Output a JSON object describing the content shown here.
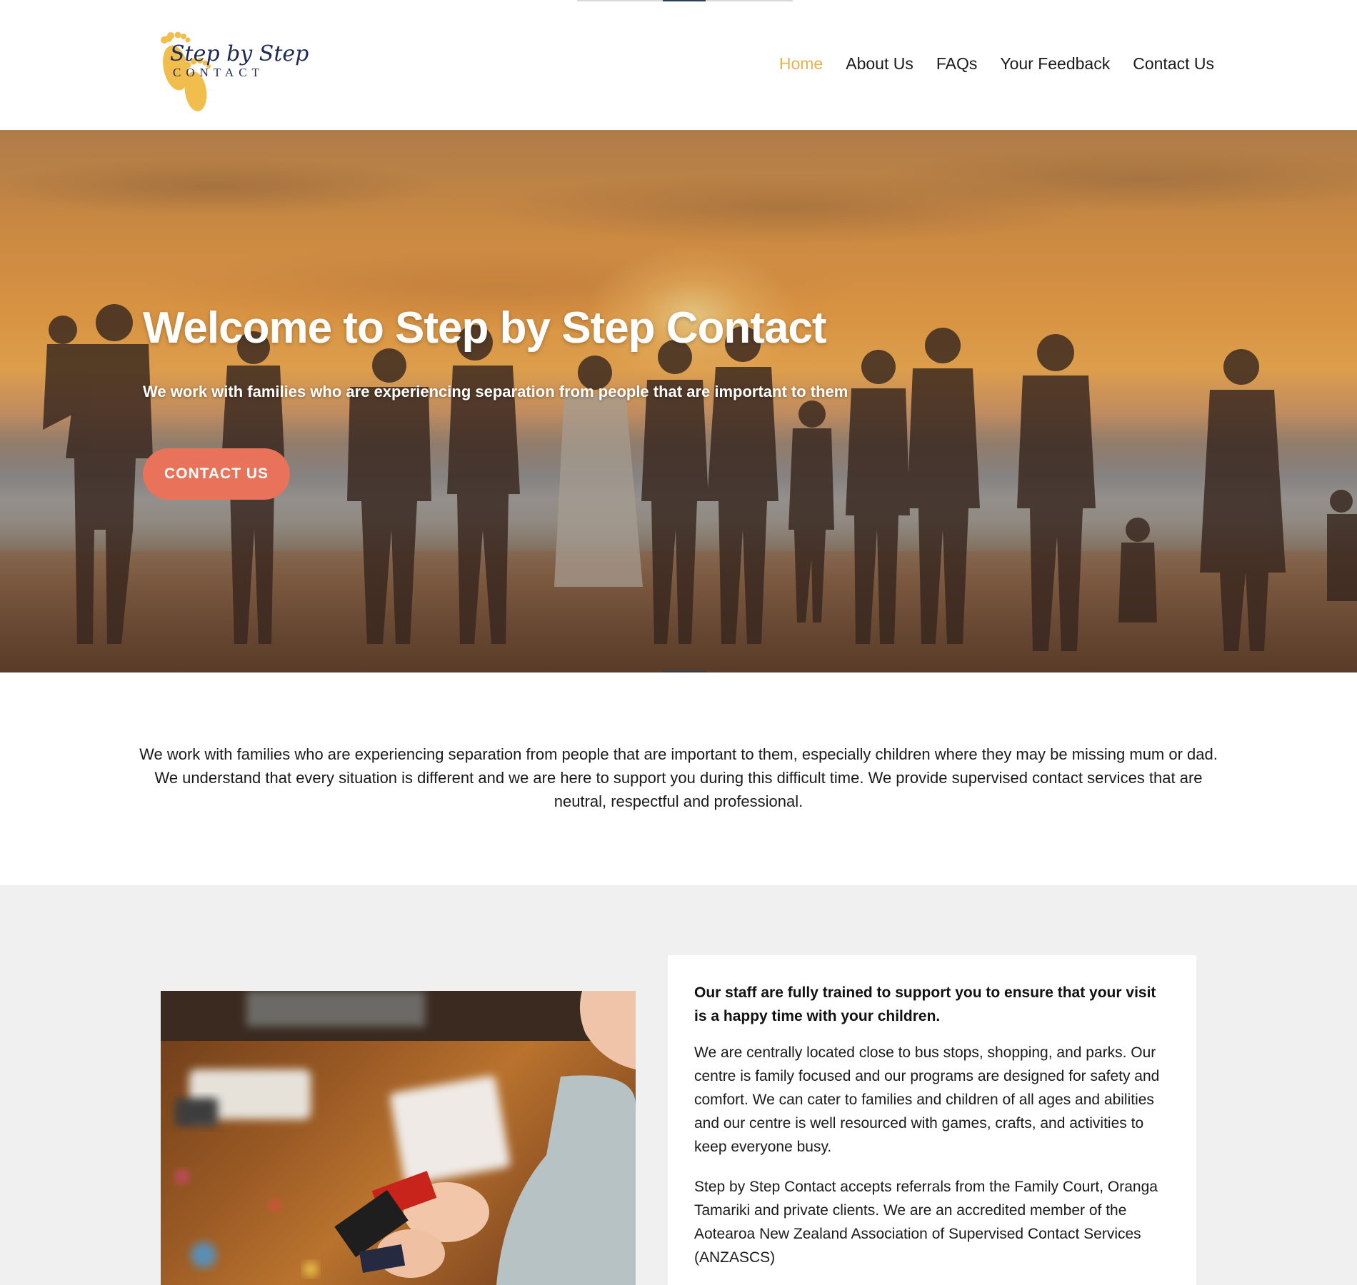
{
  "brand": {
    "logo_script": "Step by Step",
    "logo_subtitle": "CONTACT",
    "logo_color": "#f1be4e",
    "logo_text_color": "#1f2a55"
  },
  "nav": {
    "items": [
      {
        "label": "Home",
        "active": true
      },
      {
        "label": "About Us",
        "active": false
      },
      {
        "label": "FAQs",
        "active": false
      },
      {
        "label": "Your Feedback",
        "active": false
      },
      {
        "label": "Contact Us",
        "active": false
      }
    ],
    "active_color": "#e8b04e"
  },
  "hero": {
    "title": "Welcome to Step by Step Contact",
    "subtitle": "We work with families who are experiencing separation from people that are important to them",
    "button_label": "CONTACT US",
    "button_color": "#e8735a",
    "image": "family-holding-hands-on-beach-at-sunset"
  },
  "intro": {
    "text": "We work with families who are experiencing separation from people that are important to them, especially children where they may be missing mum or dad. We understand that every situation is different and we are here to support you during this difficult time. We provide supervised contact services that are neutral, respectful and professional."
  },
  "info": {
    "image": "child-playing-with-toy-blocks",
    "lead": "Our staff are fully trained to support you to ensure that your visit is a happy time with your children.",
    "paragraph_1": "We are centrally located close to bus stops, shopping, and parks. Our centre is family focused and our programs are designed for safety and comfort. We can cater to families and children of all ages and abilities and our centre is well resourced with games, crafts, and activities to keep everyone busy.",
    "paragraph_2": "Step by Step Contact accepts referrals from the Family Court, Oranga Tamariki and private clients. We are an accredited member of the Aotearoa New Zealand Association of Supervised Contact Services (ANZASCS)",
    "background_color": "#f0f0f0"
  }
}
